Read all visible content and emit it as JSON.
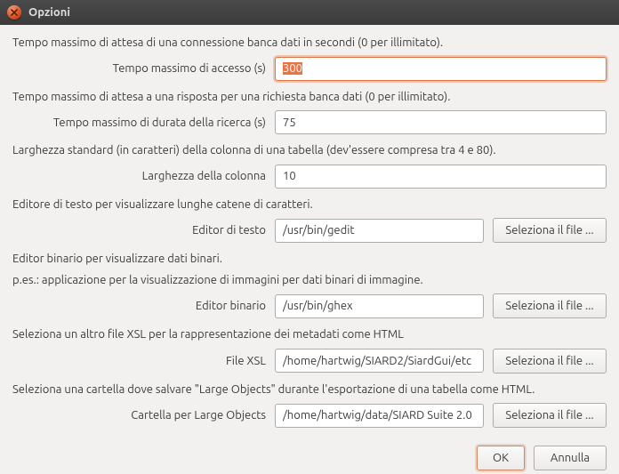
{
  "window": {
    "title": "Opzioni"
  },
  "groups": {
    "conn": {
      "desc": "Tempo massimo di attesa di una connessione banca dati in secondi (0 per illimitato).",
      "label": "Tempo massimo di accesso (s)",
      "value": "300"
    },
    "query": {
      "desc": "Tempo massimo di attesa a una risposta per una richiesta banca dati (0 per illimitato).",
      "label": "Tempo massimo di durata della ricerca (s)",
      "value": "75"
    },
    "colwidth": {
      "desc": "Larghezza standard (in caratteri) della colonna di una tabella (dev'essere compresa tra 4 e 80).",
      "label": "Larghezza della colonna",
      "value": "10"
    },
    "texted": {
      "desc": "Editore di testo per visualizzare lunghe catene di caratteri.",
      "label": "Editor di testo",
      "value": "/usr/bin/gedit",
      "button": "Seleziona il file ..."
    },
    "bined": {
      "desc1": "Editor binario per visualizzare dati binari.",
      "desc2": "p.es.: applicazione per la visualizzazione di immagini per dati binari di immagine.",
      "label": "Editor binario",
      "value": "/usr/bin/ghex",
      "button": "Seleziona il file ..."
    },
    "xsl": {
      "desc": "Seleziona un altro file XSL per la rappresentazione dei metadati come HTML",
      "label": "File XSL",
      "value": "/home/hartwig/SIARD2/SiardGui/etc",
      "button": "Seleziona il file ..."
    },
    "lobs": {
      "desc": "Seleziona una cartella dove salvare \"Large Objects\" durante l'esportazione di una tabella come HTML.",
      "label": "Cartella per Large Objects",
      "value": "/home/hartwig/data/SIARD Suite 2.0",
      "button": "Seleziona il file ..."
    }
  },
  "footer": {
    "ok": "OK",
    "cancel": "Annulla"
  }
}
